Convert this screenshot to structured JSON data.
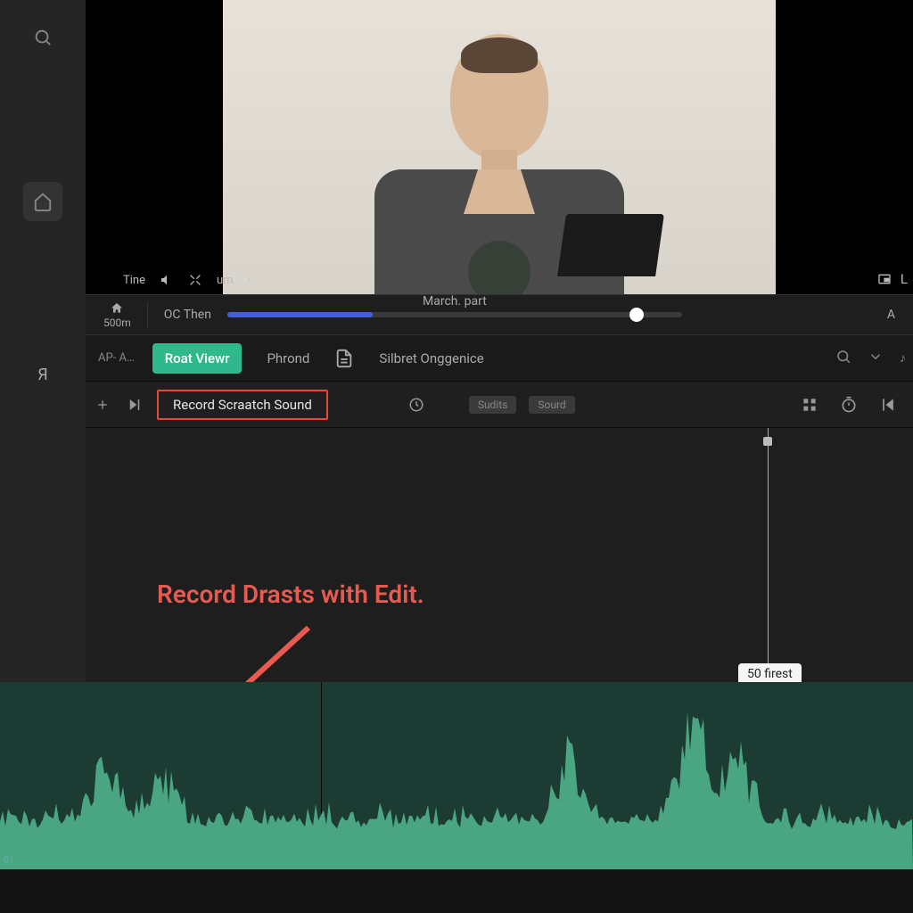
{
  "leftRail": {
    "search": "search",
    "home": "home",
    "text": "Я"
  },
  "preview": {
    "timeLabel": "Tine",
    "umLabel": "um",
    "rightChars": [
      "☐",
      "L"
    ]
  },
  "infoRow": {
    "homeZoom": "500m",
    "leftLabel": "OC Then",
    "midLabel": "March. part",
    "rightChar": "A"
  },
  "tabs": {
    "leftShort": "AP- A…",
    "primary": "Roat Viewr",
    "secondary": "Phrond",
    "silbret": "Silbret Onggenice"
  },
  "trackRow": {
    "recordLabel": "Record Scraatch Sound",
    "pill1": "Sudits",
    "pill2": "Sourd"
  },
  "annotation": "Record Drasts with Edit.",
  "tooltip": "50 firest",
  "waveLabel": "01"
}
